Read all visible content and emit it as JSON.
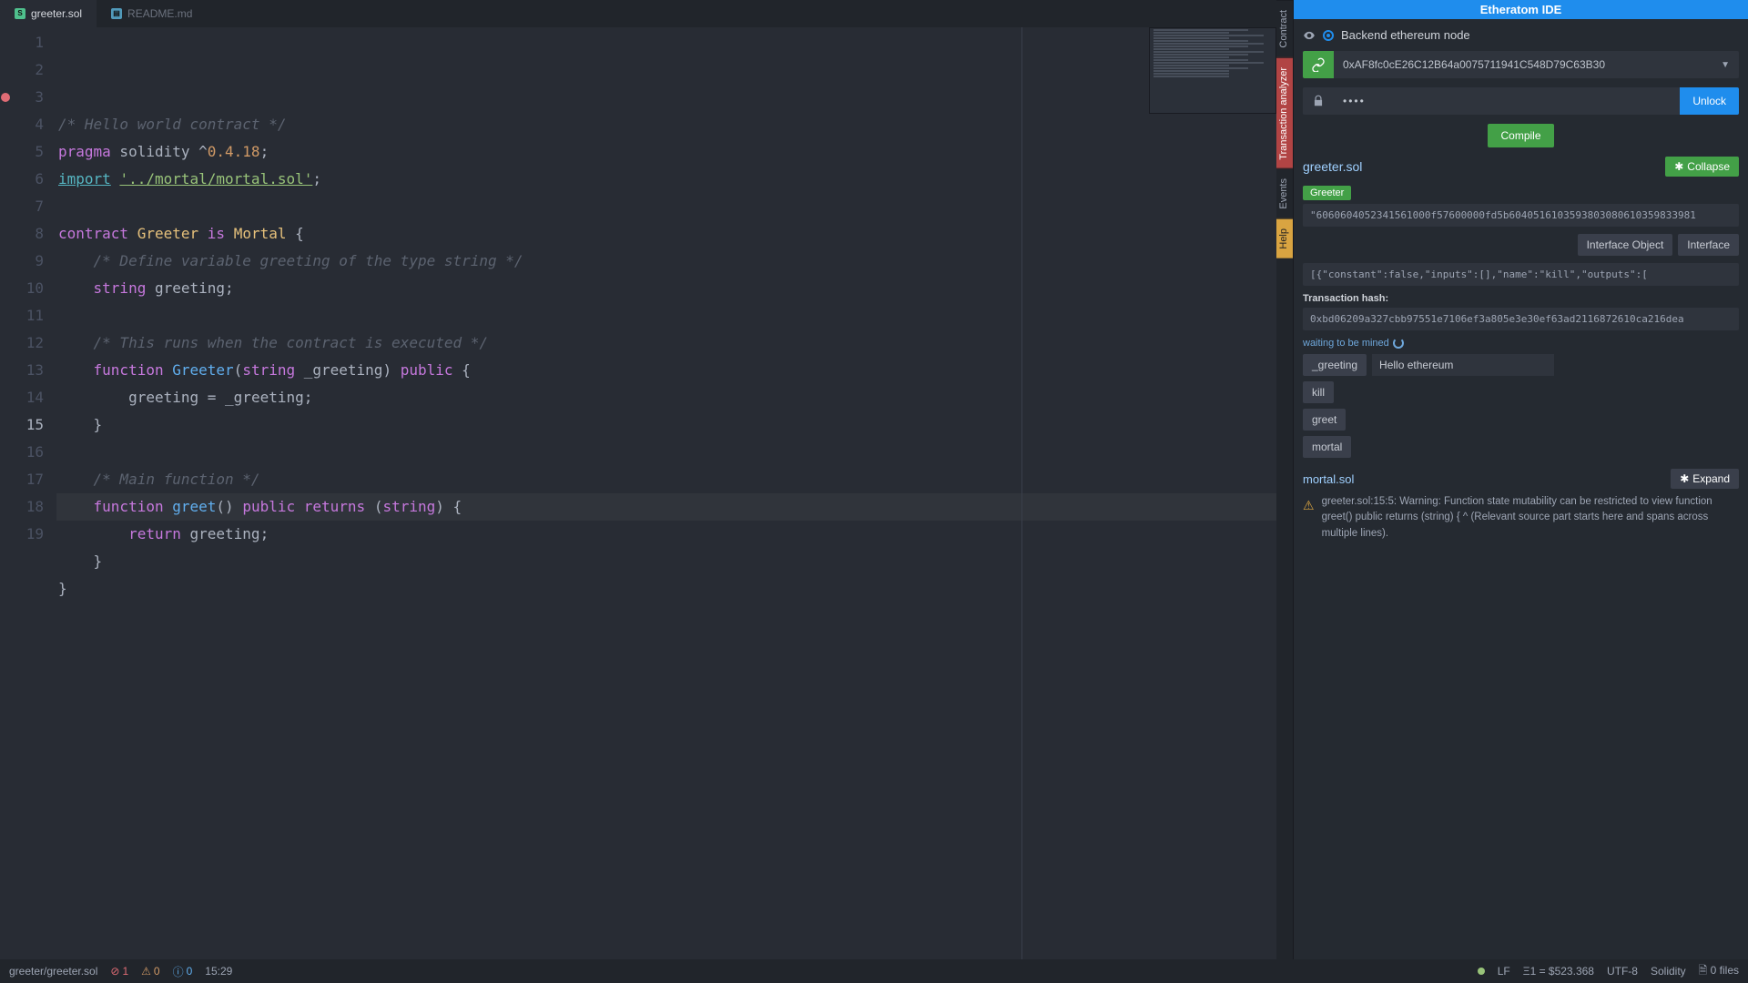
{
  "tabs": [
    {
      "label": "greeter.sol",
      "active": true,
      "icon": "sol"
    },
    {
      "label": "README.md",
      "active": false,
      "icon": "md"
    }
  ],
  "editor": {
    "active_line": 15,
    "breakpoint_line": 3,
    "lines": [
      {
        "n": 1,
        "seg": [
          {
            "c": "tok-comment",
            "t": "/* Hello world contract */"
          }
        ]
      },
      {
        "n": 2,
        "seg": [
          {
            "c": "tok-key",
            "t": "pragma"
          },
          {
            "c": "",
            "t": " solidity "
          },
          {
            "c": "tok-punc",
            "t": "^"
          },
          {
            "c": "tok-num",
            "t": "0.4.18"
          },
          {
            "c": "tok-punc",
            "t": ";"
          }
        ]
      },
      {
        "n": 3,
        "seg": [
          {
            "c": "tok-import",
            "t": "import"
          },
          {
            "c": "",
            "t": " "
          },
          {
            "c": "tok-importstr",
            "t": "'../mortal/mortal.sol'"
          },
          {
            "c": "tok-punc",
            "t": ";"
          }
        ]
      },
      {
        "n": 4,
        "seg": []
      },
      {
        "n": 5,
        "seg": [
          {
            "c": "tok-key",
            "t": "contract"
          },
          {
            "c": "",
            "t": " "
          },
          {
            "c": "tok-ident",
            "t": "Greeter"
          },
          {
            "c": "",
            "t": " "
          },
          {
            "c": "tok-key",
            "t": "is"
          },
          {
            "c": "",
            "t": " "
          },
          {
            "c": "tok-ident",
            "t": "Mortal"
          },
          {
            "c": "",
            "t": " "
          },
          {
            "c": "tok-punc",
            "t": "{"
          }
        ]
      },
      {
        "n": 6,
        "seg": [
          {
            "c": "",
            "t": "    "
          },
          {
            "c": "tok-comment",
            "t": "/* Define variable greeting of the type string */"
          }
        ]
      },
      {
        "n": 7,
        "seg": [
          {
            "c": "",
            "t": "    "
          },
          {
            "c": "tok-type",
            "t": "string"
          },
          {
            "c": "",
            "t": " greeting"
          },
          {
            "c": "tok-punc",
            "t": ";"
          }
        ]
      },
      {
        "n": 8,
        "seg": []
      },
      {
        "n": 9,
        "seg": [
          {
            "c": "",
            "t": "    "
          },
          {
            "c": "tok-comment",
            "t": "/* This runs when the contract is executed */"
          }
        ]
      },
      {
        "n": 10,
        "seg": [
          {
            "c": "",
            "t": "    "
          },
          {
            "c": "tok-key",
            "t": "function"
          },
          {
            "c": "",
            "t": " "
          },
          {
            "c": "tok-ident2",
            "t": "Greeter"
          },
          {
            "c": "tok-punc",
            "t": "("
          },
          {
            "c": "tok-type",
            "t": "string"
          },
          {
            "c": "",
            "t": " _greeting"
          },
          {
            "c": "tok-punc",
            "t": ")"
          },
          {
            "c": "",
            "t": " "
          },
          {
            "c": "tok-key",
            "t": "public"
          },
          {
            "c": "",
            "t": " "
          },
          {
            "c": "tok-punc",
            "t": "{"
          }
        ]
      },
      {
        "n": 11,
        "seg": [
          {
            "c": "",
            "t": "        greeting "
          },
          {
            "c": "tok-punc",
            "t": "="
          },
          {
            "c": "",
            "t": " _greeting"
          },
          {
            "c": "tok-punc",
            "t": ";"
          }
        ]
      },
      {
        "n": 12,
        "seg": [
          {
            "c": "",
            "t": "    "
          },
          {
            "c": "tok-punc",
            "t": "}"
          }
        ]
      },
      {
        "n": 13,
        "seg": []
      },
      {
        "n": 14,
        "seg": [
          {
            "c": "",
            "t": "    "
          },
          {
            "c": "tok-comment",
            "t": "/* Main function */"
          }
        ]
      },
      {
        "n": 15,
        "seg": [
          {
            "c": "",
            "t": "    "
          },
          {
            "c": "tok-key",
            "t": "function"
          },
          {
            "c": "",
            "t": " "
          },
          {
            "c": "tok-ident2",
            "t": "greet"
          },
          {
            "c": "tok-punc",
            "t": "()"
          },
          {
            "c": "",
            "t": " "
          },
          {
            "c": "tok-key",
            "t": "public"
          },
          {
            "c": "",
            "t": " "
          },
          {
            "c": "tok-key",
            "t": "returns"
          },
          {
            "c": "",
            "t": " "
          },
          {
            "c": "tok-punc",
            "t": "("
          },
          {
            "c": "tok-type",
            "t": "string"
          },
          {
            "c": "tok-punc",
            "t": ")"
          },
          {
            "c": "",
            "t": " "
          },
          {
            "c": "tok-punc",
            "t": "{"
          }
        ]
      },
      {
        "n": 16,
        "seg": [
          {
            "c": "",
            "t": "        "
          },
          {
            "c": "tok-key",
            "t": "return"
          },
          {
            "c": "",
            "t": " greeting"
          },
          {
            "c": "tok-punc",
            "t": ";"
          }
        ]
      },
      {
        "n": 17,
        "seg": [
          {
            "c": "",
            "t": "    "
          },
          {
            "c": "tok-punc",
            "t": "}"
          }
        ]
      },
      {
        "n": 18,
        "seg": [
          {
            "c": "tok-punc",
            "t": "}"
          }
        ]
      },
      {
        "n": 19,
        "seg": []
      }
    ]
  },
  "vtabs": [
    {
      "label": "Contract",
      "cls": ""
    },
    {
      "label": "Transaction analyzer",
      "cls": "red"
    },
    {
      "label": "Events",
      "cls": ""
    },
    {
      "label": "Help",
      "cls": "yellow"
    }
  ],
  "panel": {
    "title": "Etheratom IDE",
    "node_label": "Backend ethereum node",
    "account": "0xAF8fc0cE26C12B64a0075711941C548D79C63B30",
    "password_mask": "••••",
    "unlock": "Unlock",
    "compile": "Compile",
    "file": "greeter.sol",
    "collapse": "Collapse",
    "contract_badge": "Greeter",
    "bytecode": "\"6060604052341561000f57600000fd5b6040516103593803080610359833981",
    "btn_iface_obj": "Interface Object",
    "btn_iface": "Interface",
    "abi": "[{\"constant\":false,\"inputs\":[],\"name\":\"kill\",\"outputs\":[",
    "txhash_label": "Transaction hash:",
    "txhash": "0xbd06209a327cbb97551e7106ef3a805e3e30ef63ad2116872610ca216dea",
    "mining": "waiting to be mined",
    "functions": [
      {
        "name": "_greeting",
        "input": "Hello ethereum"
      },
      {
        "name": "kill"
      },
      {
        "name": "greet"
      },
      {
        "name": "mortal"
      }
    ],
    "file2": "mortal.sol",
    "expand": "Expand",
    "warning": "greeter.sol:15:5: Warning: Function state mutability can be restricted to view function greet() public returns (string) { ^ (Relevant source part starts here and spans across multiple lines)."
  },
  "statusbar": {
    "path": "greeter/greeter.sol",
    "errors": "1",
    "warnings": "0",
    "info": "0",
    "cursor": "15:29",
    "lf": "LF",
    "balance": "Ξ1 = $523.368",
    "encoding": "UTF-8",
    "lang": "Solidity",
    "files": "0 files"
  }
}
